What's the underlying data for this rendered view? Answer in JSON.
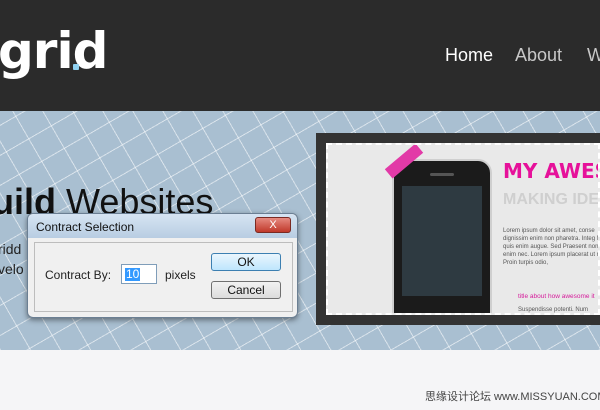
{
  "header": {
    "logo_text": "grid",
    "nav": [
      "Home",
      "About",
      "W"
    ]
  },
  "hero": {
    "headline_bold": "uild",
    "headline_rest": " Websites",
    "sub_line1": "ridd",
    "sub_line2": "velo"
  },
  "preview": {
    "awesome_text": "MY AWESOM",
    "making_text": "MAKING IDE",
    "lorem_text": "Lorem ipsum dolor sit amet, conse dignissim enim non pharetra. Integ Nunc quis enim augue. Sed Praesent non enim nec. Lorem ipsum placerat ut mbh. Proin turpis odio,",
    "pink_text": "title about how awesome it",
    "suspend_text": "Suspendisse potenti. Num"
  },
  "dialog": {
    "title": "Contract Selection",
    "close_label": "X",
    "contract_label": "Contract By:",
    "contract_value": "10",
    "pixels_label": "pixels",
    "ok_label": "OK",
    "cancel_label": "Cancel"
  },
  "footer": {
    "watermark": "思缘设计论坛  www.MISSYUAN.COM"
  }
}
